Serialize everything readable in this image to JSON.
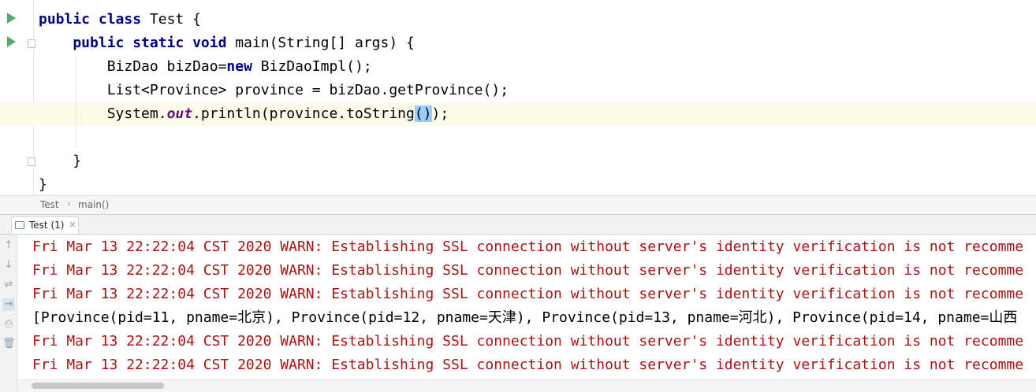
{
  "editor": {
    "lines": [
      {
        "parts": [
          {
            "t": "public class ",
            "k": "kw"
          },
          {
            "t": "Test {",
            "k": ""
          }
        ]
      },
      {
        "parts": [
          {
            "t": "    public static void ",
            "k": "kw"
          },
          {
            "t": "main(String[] args) {",
            "k": ""
          }
        ]
      },
      {
        "parts": [
          {
            "t": "        BizDao bizDao=",
            "k": ""
          },
          {
            "t": "new ",
            "k": "kw"
          },
          {
            "t": "BizDaoImpl();",
            "k": ""
          }
        ]
      },
      {
        "parts": [
          {
            "t": "        List<Province> province = bizDao.getProvince();",
            "k": ""
          }
        ]
      },
      {
        "parts": [
          {
            "t": "        System.",
            "k": ""
          },
          {
            "t": "out",
            "k": "static-field"
          },
          {
            "t": ".println(province.toString",
            "k": ""
          },
          {
            "t": "()",
            "k": "brace-hl"
          },
          {
            "t": ");",
            "k": ""
          }
        ]
      },
      {
        "parts": [
          {
            "t": "",
            "k": ""
          }
        ]
      },
      {
        "parts": [
          {
            "t": "    }",
            "k": ""
          }
        ]
      },
      {
        "parts": [
          {
            "t": "}",
            "k": ""
          }
        ]
      }
    ]
  },
  "breadcrumb": {
    "items": [
      "Test",
      "main()"
    ],
    "separator": "›"
  },
  "tab": {
    "label": "Test (1)",
    "close": "×"
  },
  "tools": [
    "↑",
    "↓",
    "⇌",
    "⇥",
    "⎙",
    "🗑"
  ],
  "console": {
    "lines": [
      {
        "type": "err",
        "text": "Fri Mar 13 22:22:04 CST 2020 WARN: Establishing SSL connection without server's identity verification is not recomme"
      },
      {
        "type": "err",
        "text": "Fri Mar 13 22:22:04 CST 2020 WARN: Establishing SSL connection without server's identity verification is not recomme"
      },
      {
        "type": "err",
        "text": "Fri Mar 13 22:22:04 CST 2020 WARN: Establishing SSL connection without server's identity verification is not recomme"
      },
      {
        "type": "out",
        "text": "[Province(pid=11, pname=北京), Province(pid=12, pname=天津), Province(pid=13, pname=河北), Province(pid=14, pname=山西"
      },
      {
        "type": "err",
        "text": "Fri Mar 13 22:22:04 CST 2020 WARN: Establishing SSL connection without server's identity verification is not recomme"
      },
      {
        "type": "err",
        "text": "Fri Mar 13 22:22:04 CST 2020 WARN: Establishing SSL connection without server's identity verification is not recomme"
      }
    ]
  }
}
